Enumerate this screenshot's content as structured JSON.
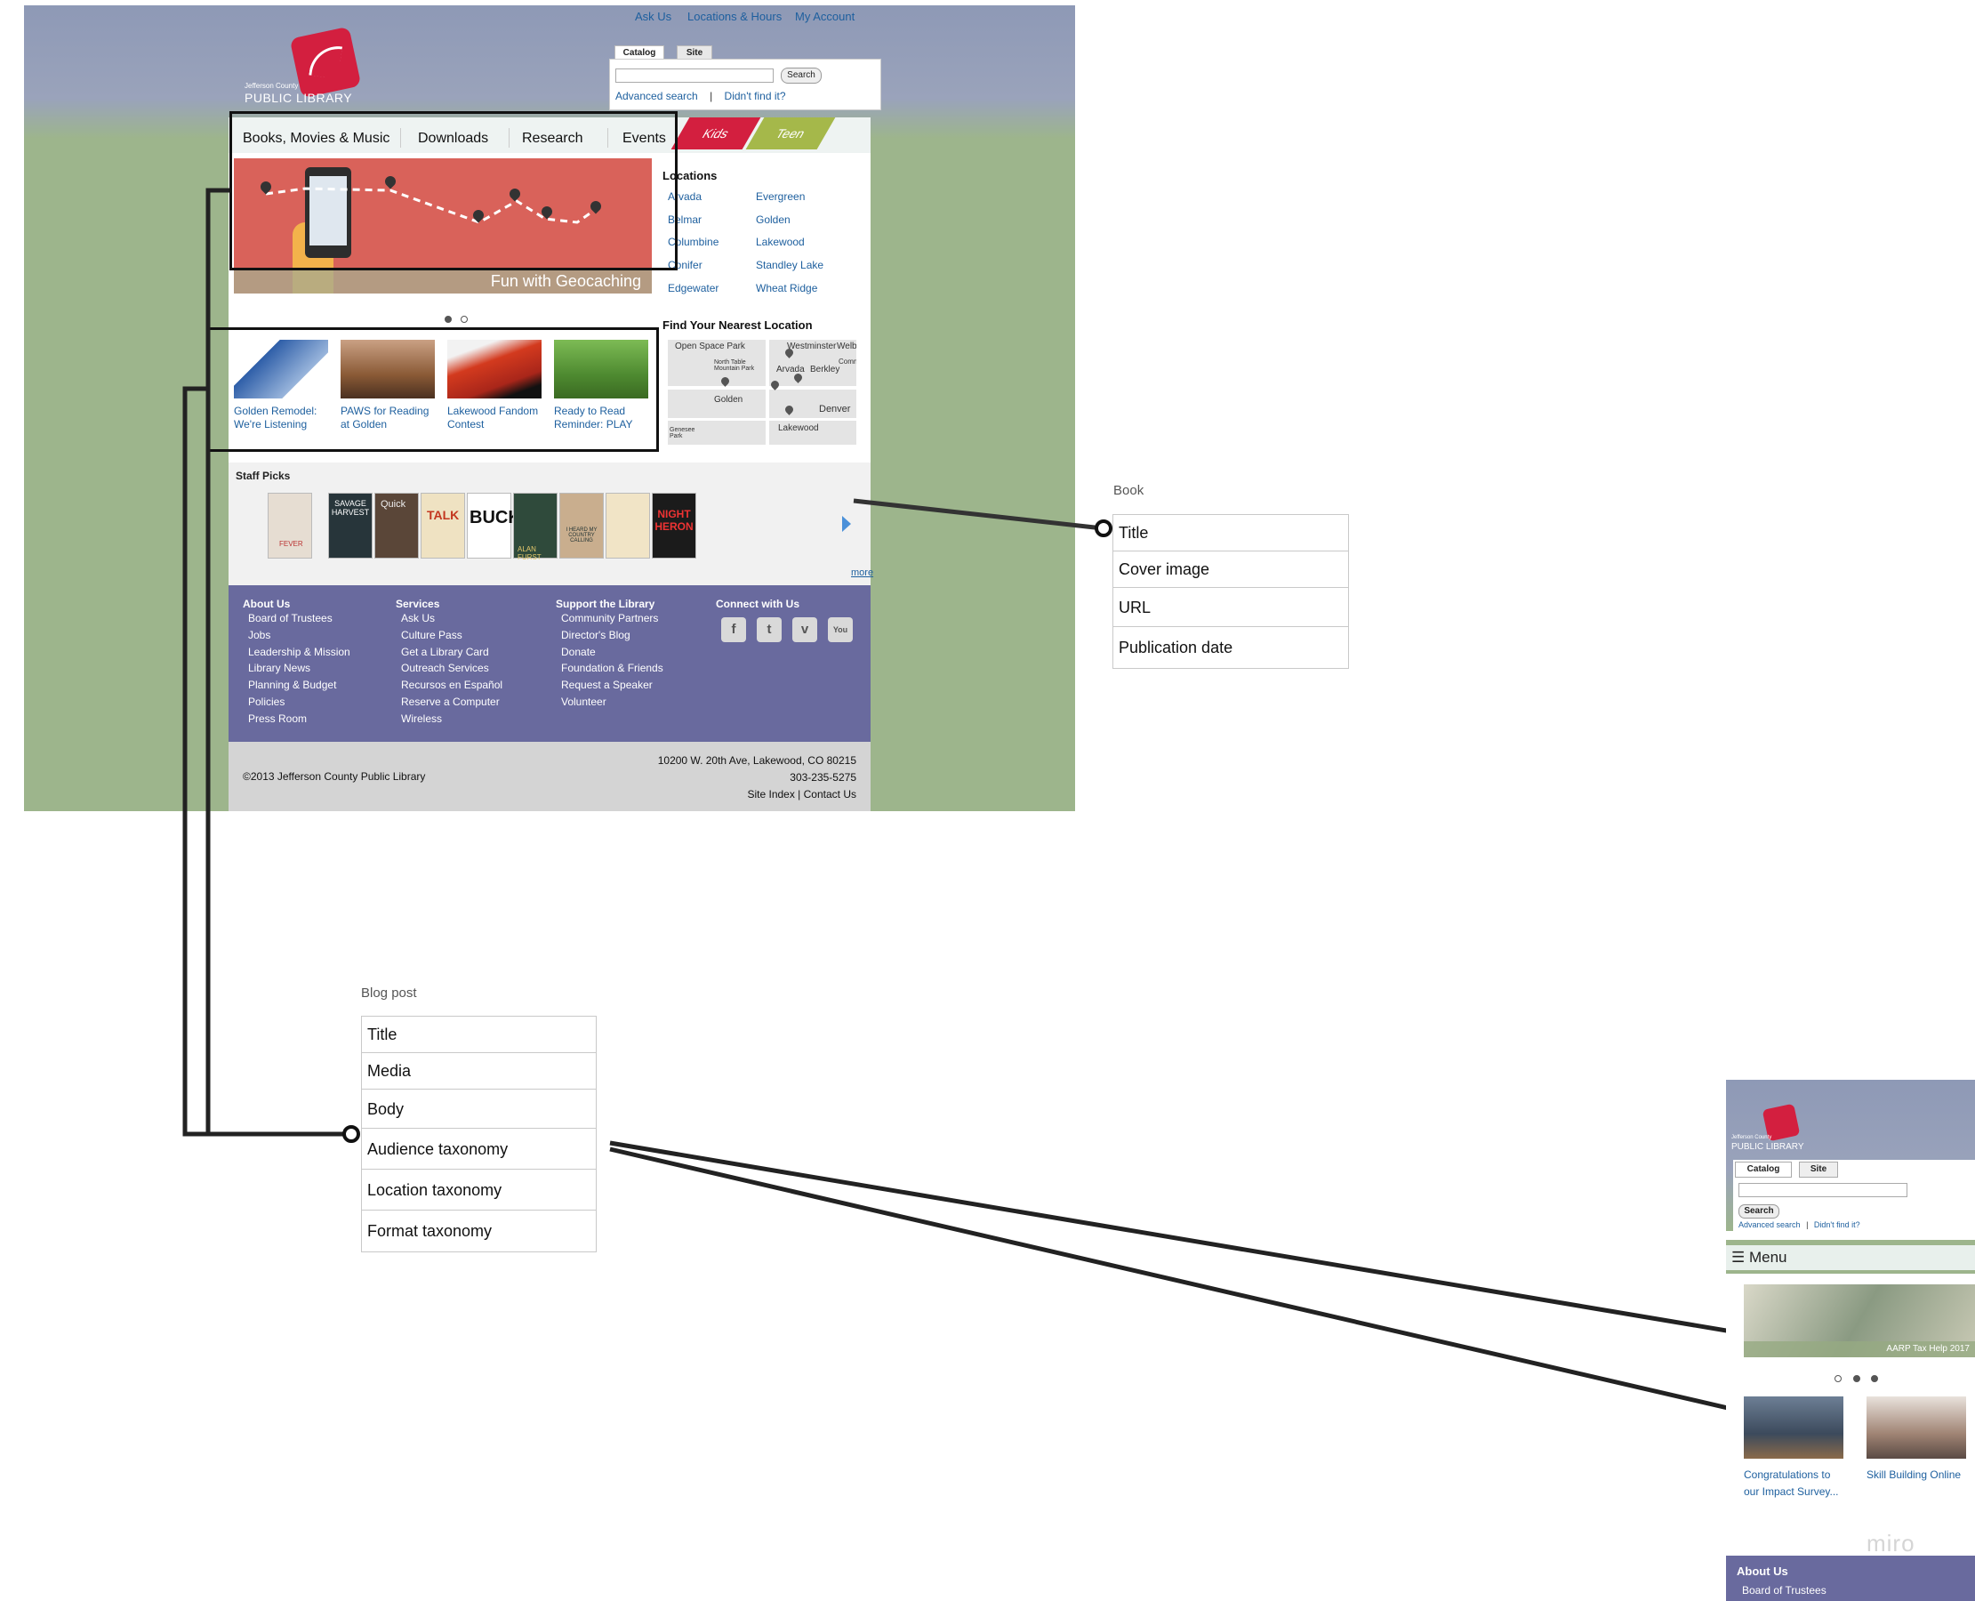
{
  "toplinks": [
    "Ask Us",
    "Locations & Hours",
    "My Account"
  ],
  "logo": {
    "small": "Jefferson County",
    "big": "PUBLIC LIBRARY"
  },
  "search": {
    "tabs": [
      "Catalog",
      "Site"
    ],
    "button": "Search",
    "advanced": "Advanced search",
    "sep": "|",
    "didnt": "Didn't find it?"
  },
  "nav": [
    "Books, Movies & Music",
    "Downloads",
    "Research",
    "Events"
  ],
  "ribbons": [
    "Kids",
    "Teen"
  ],
  "hero": {
    "caption": "Fun with Geocaching"
  },
  "locations": {
    "heading": "Locations",
    "col1": [
      "Arvada",
      "Belmar",
      "Columbine",
      "Conifer",
      "Edgewater"
    ],
    "col2": [
      "Evergreen",
      "Golden",
      "Lakewood",
      "Standley Lake",
      "Wheat Ridge"
    ]
  },
  "nearest": {
    "heading": "Find Your Nearest Location",
    "labels": [
      "Open Space Park",
      "Westminster",
      "Welby",
      "North Table Mountain Park",
      "Arvada",
      "Berkley",
      "Golden",
      "Denver",
      "Lakewood",
      "Genesee Park",
      "Comm"
    ]
  },
  "teasers": [
    {
      "title": "Golden Remodel: We're Listening"
    },
    {
      "title": "PAWS for Reading at Golden"
    },
    {
      "title": "Lakewood Fandom Contest"
    },
    {
      "title": "Ready to Read Reminder: PLAY"
    }
  ],
  "staff": {
    "heading": "Staff Picks",
    "more": "more",
    "books": [
      "FEVER",
      "SAVAGE HARVEST",
      "Quick",
      "TALK",
      "BUCK",
      "ALAN FURST",
      "I HEARD MY COUNTRY CALLING",
      "",
      "NIGHT HERON"
    ]
  },
  "footer": {
    "columns": [
      {
        "heading": "About Us",
        "items": [
          "Board of Trustees",
          "Jobs",
          "Leadership & Mission",
          "Library News",
          "Planning & Budget",
          "Policies",
          "Press Room"
        ]
      },
      {
        "heading": "Services",
        "items": [
          "Ask Us",
          "Culture Pass",
          "Get a Library Card",
          "Outreach Services",
          "Recursos en Español",
          "Reserve a Computer",
          "Wireless"
        ]
      },
      {
        "heading": "Support the Library",
        "items": [
          "Community Partners",
          "Director's Blog",
          "Donate",
          "Foundation & Friends",
          "Request a Speaker",
          "Volunteer"
        ]
      },
      {
        "heading": "Connect with Us",
        "items": []
      }
    ],
    "social": [
      "f",
      "t",
      "v",
      "You"
    ]
  },
  "bottom": {
    "copyright": "©2013 Jefferson County Public Library",
    "address": "10200 W. 20th Ave, Lakewood, CO 80215",
    "phone": "303-235-5275",
    "links": "Site Index | Contact Us"
  },
  "book_model": {
    "title": "Book",
    "fields": [
      "Title",
      "Cover image",
      "URL",
      "Publication date"
    ]
  },
  "blog_model": {
    "title": "Blog post",
    "fields": [
      "Title",
      "Media",
      "Body",
      "Audience taxonomy",
      "Location taxonomy",
      "Format taxonomy"
    ]
  },
  "mobile": {
    "logo_small": "Jefferson County",
    "logo_big": "PUBLIC LIBRARY",
    "tabs": [
      "Catalog",
      "Site"
    ],
    "search_button": "Search",
    "advanced": "Advanced search",
    "sep": "|",
    "didnt": "Didn't find it?",
    "menu": "Menu",
    "menu_icon": "☰",
    "hero_caption": "AARP Tax Help 2017",
    "cards": [
      "Congratulations to our Impact Survey...",
      "Skill Building Online"
    ],
    "footer_heading": "About Us",
    "footer_item": "Board of Trustees"
  },
  "watermark": "miro"
}
